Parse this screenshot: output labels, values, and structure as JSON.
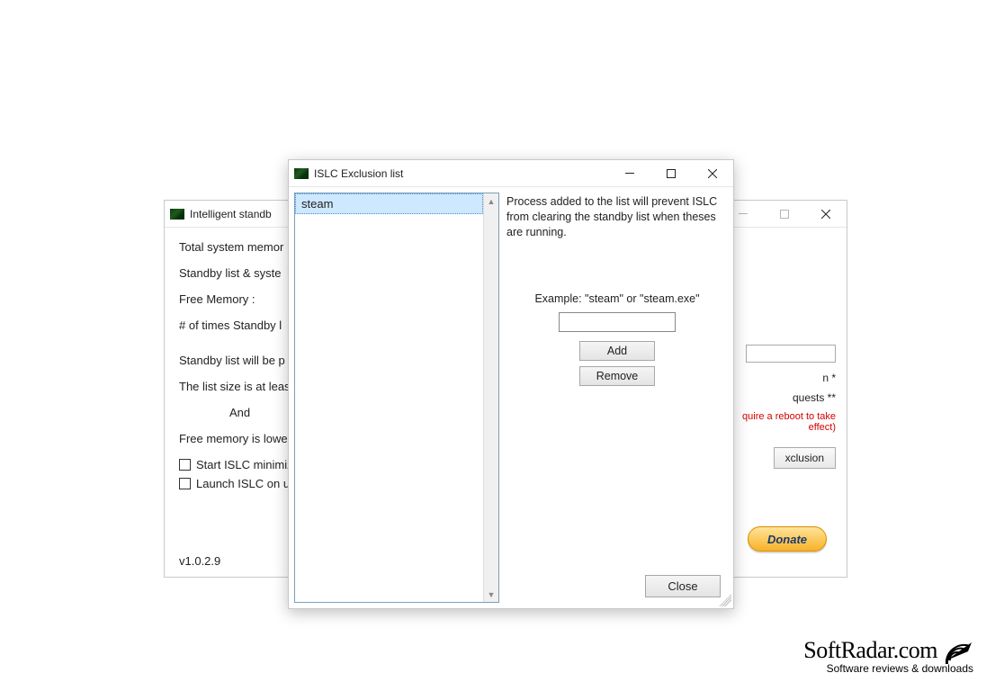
{
  "main_window": {
    "title": "Intelligent standb",
    "labels": {
      "total_mem": "Total system memor",
      "standby_sys": "Standby list & syste",
      "free_mem": "Free Memory :",
      "times_standby": "# of times Standby l",
      "purged_when": "Standby list will be p",
      "list_size": "The list size is at leas",
      "and": "And",
      "free_lower": "Free memory is lowe",
      "start_minimized": "Start ISLC minimiz",
      "launch_on": "Launch ISLC on u",
      "version": "v1.0.2.9"
    },
    "side": {
      "n_star": "n *",
      "quests": "quests **",
      "reboot_note": "quire a reboot to take effect)",
      "exclusion_btn": "xclusion"
    },
    "donate": "Donate"
  },
  "exclusion_window": {
    "title": "ISLC Exclusion list",
    "list_items": [
      "steam"
    ],
    "description": "Process added to the list will prevent ISLC from clearing the standby list when theses are running.",
    "example_label": "Example: \"steam\" or \"steam.exe\"",
    "input_value": "",
    "add_btn": "Add",
    "remove_btn": "Remove",
    "close_btn": "Close"
  },
  "watermark": {
    "brand": "SoftRadar.com",
    "tagline": "Software reviews & downloads"
  }
}
